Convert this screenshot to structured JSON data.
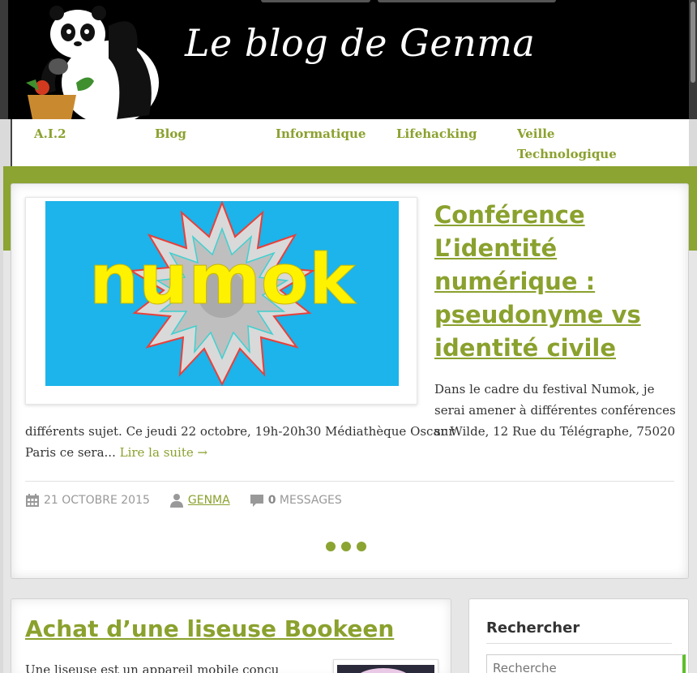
{
  "site": {
    "title": "Le blog de Genma"
  },
  "nav": {
    "items": [
      {
        "label": "A.I.2"
      },
      {
        "label": "Blog"
      },
      {
        "label": "Informatique"
      },
      {
        "label": "Lifehacking"
      },
      {
        "label": "Veille Technologique"
      }
    ]
  },
  "featured": {
    "image_text": "numok",
    "title": "Conférence L’identité numérique : pseudonyme vs identité civile",
    "excerpt_part1": "Dans le cadre du festival Numok, je serai amener à différentes conférences sur",
    "excerpt_part2": "différents sujet. Ce jeudi 22 octobre, 19h-20h30 Médiathèque Oscar Wilde, 12 Rue du Télégraphe, 75020 Paris ce sera... ",
    "read_more": "Lire la suite →",
    "date": "21 OCTOBRE 2015",
    "author": "GENMA",
    "comments_count": "0",
    "comments_label": "MESSAGES"
  },
  "slider": {
    "dots": 3
  },
  "post": {
    "title": "Achat d’une liseuse Bookeen",
    "excerpt": "Une liseuse est un appareil mobile conçu"
  },
  "sidebar": {
    "search_title": "Rechercher",
    "search_placeholder": "Recherche"
  },
  "colors": {
    "accent": "#8aa12e",
    "band": "#8ba432",
    "header_bg": "#000000",
    "feature_img_bg": "#1cb4ea",
    "feature_img_text": "#fff200"
  }
}
